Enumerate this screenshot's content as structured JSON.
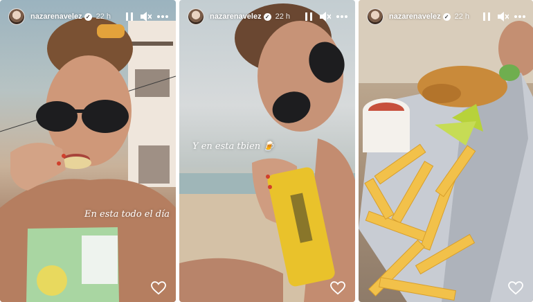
{
  "stories": [
    {
      "username": "nazarenavelez",
      "time": "22 h",
      "caption": "En esta todo el día",
      "icons": [
        "verified-icon",
        "pause-icon",
        "mute-icon",
        "more-icon",
        "heart-icon"
      ]
    },
    {
      "username": "nazarenavelez",
      "time": "22 h",
      "caption": "Y en esta tbien 🍺",
      "icons": [
        "verified-icon",
        "pause-icon",
        "mute-icon",
        "more-icon",
        "heart-icon"
      ]
    },
    {
      "username": "nazarenavelez",
      "time": "22 h",
      "caption": "",
      "icons": [
        "verified-icon",
        "pause-icon",
        "mute-icon",
        "more-icon",
        "heart-icon"
      ]
    }
  ],
  "colors": {
    "beer_can": "#e9c22b",
    "chips_bag": "#a9d6a2",
    "fries": "#f2c14a",
    "lime": "#b7d23a",
    "foil": "#c8ccd3",
    "nail_polish": "#d0402c"
  }
}
